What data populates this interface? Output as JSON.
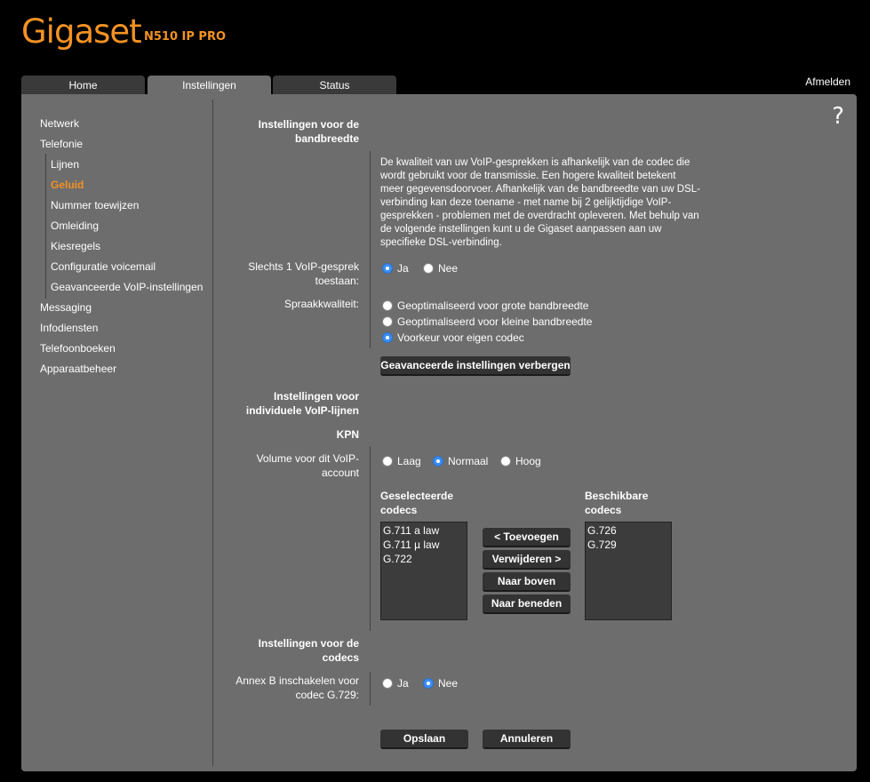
{
  "brand": {
    "logo": "Gigaset",
    "model": "N510 IP PRO"
  },
  "tabs": [
    {
      "label": "Home"
    },
    {
      "label": "Instellingen"
    },
    {
      "label": "Status"
    }
  ],
  "logout": "Afmelden",
  "help": "?",
  "nav": {
    "items": [
      "Netwerk",
      "Telefonie",
      "Lijnen",
      "Geluid",
      "Nummer toewijzen",
      "Omleiding",
      "Kiesregels",
      "Configuratie voicemail",
      "Geavanceerde VoIP-instellingen",
      "Messaging",
      "Infodiensten",
      "Telefoonboeken",
      "Apparaatbeheer"
    ]
  },
  "bandwidth": {
    "heading_1": "Instellingen voor de",
    "heading_2": "bandbreedte",
    "desc": "De kwaliteit van uw VoIP-gesprekken is afhankelijk van de codec die wordt gebruikt voor de transmissie. Een hogere kwaliteit betekent meer gegevensdoorvoer. Afhankelijk van de bandbreedte van uw DSL-verbinding kan deze toename - met name bij 2 gelijktijdige VoIP-gesprekken - problemen met de overdracht opleveren. Met behulp van de volgende instellingen kunt u de Gigaset aanpassen aan uw specifieke DSL-verbinding.",
    "single_call_label_1": "Slechts 1 VoIP-gesprek",
    "single_call_label_2": "toestaan:",
    "single_call_yes": "Ja",
    "single_call_no": "Nee",
    "quality_label": "Spraakkwaliteit:",
    "quality_options": [
      "Geoptimaliseerd voor grote bandbreedte",
      "Geoptimaliseerd voor kleine bandbreedte",
      "Voorkeur voor eigen codec"
    ],
    "hide_advanced": "Geavanceerde instellingen verbergen"
  },
  "lines": {
    "heading_1": "Instellingen voor",
    "heading_2": "individuele VoIP-lijnen",
    "provider": "KPN",
    "volume_label_1": "Volume voor dit VoIP-",
    "volume_label_2": "account",
    "volume_options": [
      "Laag",
      "Normaal",
      "Hoog"
    ],
    "selected_head_1": "Geselecteerde",
    "selected_head_2": "codecs",
    "available_head_1": "Beschikbare",
    "available_head_2": "codecs",
    "selected_codecs": [
      "G.711 a law",
      "G.711 µ law",
      "G.722"
    ],
    "available_codecs": [
      "G.726",
      "G.729"
    ],
    "buttons": {
      "add": "< Toevoegen",
      "remove": "Verwijderen >",
      "up": "Naar boven",
      "down": "Naar beneden"
    }
  },
  "codecs": {
    "heading_1": "Instellingen voor de",
    "heading_2": "codecs",
    "annex_label_1": "Annex B inschakelen voor",
    "annex_label_2": "codec G.729:",
    "yes": "Ja",
    "no": "Nee"
  },
  "footer": {
    "save": "Opslaan",
    "cancel": "Annuleren"
  },
  "colors": {
    "accent": "#f39224",
    "panel": "#6d6d6d",
    "radio_selected": "#3b8ef3"
  }
}
